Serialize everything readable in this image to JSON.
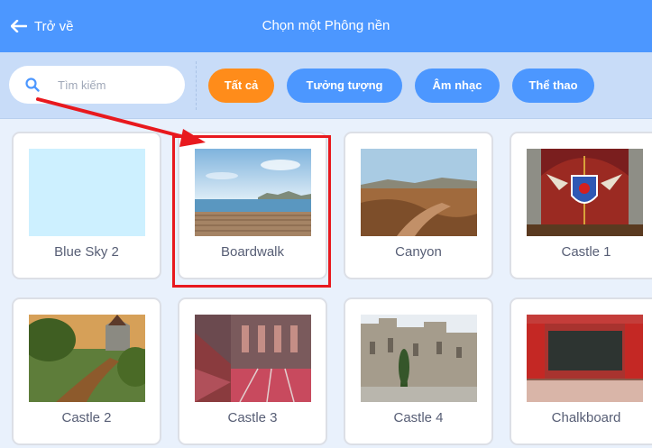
{
  "header": {
    "back_label": "Trở về",
    "title": "Chọn một Phông nền"
  },
  "search": {
    "placeholder": "Tìm kiếm",
    "value": ""
  },
  "filters": [
    {
      "label": "Tất cả",
      "active": true
    },
    {
      "label": "Tưởng tượng",
      "active": false
    },
    {
      "label": "Âm nhạc",
      "active": false
    },
    {
      "label": "Thể thao",
      "active": false
    }
  ],
  "backdrops": [
    {
      "name": "Blue Sky 2"
    },
    {
      "name": "Boardwalk"
    },
    {
      "name": "Canyon"
    },
    {
      "name": "Castle 1"
    },
    {
      "name": "Castle 2"
    },
    {
      "name": "Castle 3"
    },
    {
      "name": "Castle 4"
    },
    {
      "name": "Chalkboard"
    }
  ],
  "colors": {
    "header": "#4c97ff",
    "active_filter": "#ff8c1a",
    "filter": "#4c97ff",
    "annotation": "#e8191e"
  }
}
